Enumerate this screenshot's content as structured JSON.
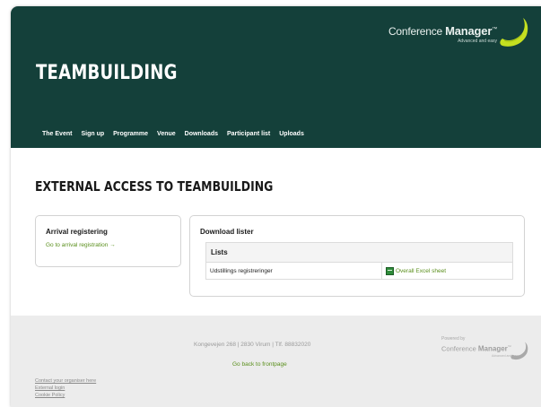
{
  "header": {
    "logo": {
      "name": "Conference",
      "name_bold": "Manager",
      "tm": "™",
      "tagline": "Advanced and easy"
    },
    "event_title": "TEAMBUILDING",
    "nav": [
      {
        "label": "The Event"
      },
      {
        "label": "Sign up"
      },
      {
        "label": "Programme"
      },
      {
        "label": "Venue"
      },
      {
        "label": "Downloads"
      },
      {
        "label": "Participant list"
      },
      {
        "label": "Uploads"
      }
    ]
  },
  "main": {
    "heading": "EXTERNAL ACCESS TO TEAMBUILDING",
    "arrival": {
      "title": "Arrival registering",
      "link": "Go to arrival registration →"
    },
    "downloads": {
      "title": "Download lister",
      "table_header": "Lists",
      "rows": [
        {
          "name": "Udstillings registreringer",
          "link": "Overall Excel sheet",
          "icon": "excel-icon"
        }
      ]
    }
  },
  "footer": {
    "address": "Kongevejen 268 | 2830 Virum | Tlf. 88832020",
    "home_link": "Go back to frontpage",
    "powered_by": "Powered by",
    "logo": {
      "name": "Conference",
      "name_bold": "Manager",
      "tm": "™",
      "tagline": "Advanced and easy"
    },
    "links": [
      {
        "label": "Contact your organiser here"
      },
      {
        "label": "External login"
      },
      {
        "label": "Cookie Policy"
      }
    ]
  },
  "colors": {
    "header_bg": "#14403a",
    "accent_green": "#5a8f1c",
    "logo_yellow": "#c5e020",
    "footer_bg": "#ececec"
  }
}
